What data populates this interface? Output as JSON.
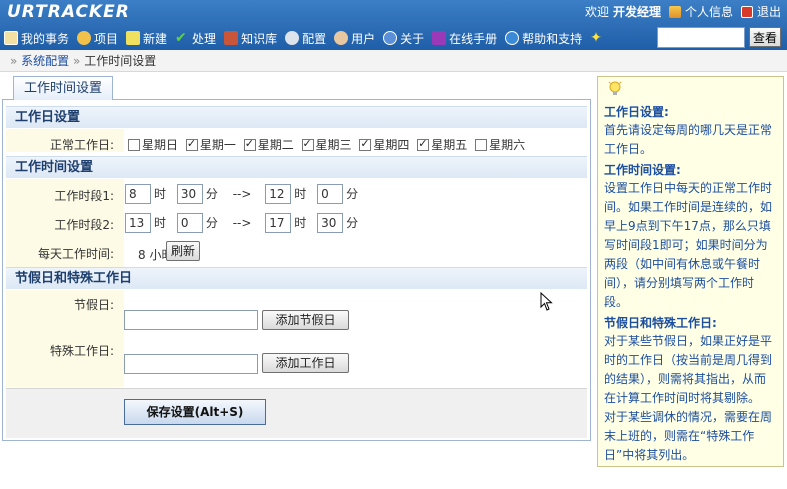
{
  "header": {
    "logo": "URTRACKER",
    "welcome": "欢迎",
    "username": "开发经理",
    "profile_link": "个人信息",
    "logout_link": "退出"
  },
  "nav": [
    {
      "label": "我的事务",
      "icon": "home-icon"
    },
    {
      "label": "项目",
      "icon": "project-icon"
    },
    {
      "label": "新建",
      "icon": "new-icon"
    },
    {
      "label": "处理",
      "icon": "check-icon"
    },
    {
      "label": "知识库",
      "icon": "knowledge-icon"
    },
    {
      "label": "配置",
      "icon": "gear-icon"
    },
    {
      "label": "用户",
      "icon": "users-icon"
    },
    {
      "label": "关于",
      "icon": "info-icon"
    },
    {
      "label": "在线手册",
      "icon": "book-icon"
    },
    {
      "label": "帮助和支持",
      "icon": "help-icon"
    }
  ],
  "search": {
    "value": "",
    "button": "查看"
  },
  "breadcrumb": {
    "sep": "»",
    "parent": "系统配置",
    "current": "工作时间设置"
  },
  "tab": "工作时间设置",
  "sections": {
    "workdays": "工作日设置",
    "worktime": "工作时间设置",
    "holidays": "节假日和特殊工作日"
  },
  "workdays": {
    "label": "正常工作日:",
    "days": [
      {
        "name": "星期日",
        "checked": false
      },
      {
        "name": "星期一",
        "checked": true
      },
      {
        "name": "星期二",
        "checked": true
      },
      {
        "name": "星期三",
        "checked": true
      },
      {
        "name": "星期四",
        "checked": true
      },
      {
        "name": "星期五",
        "checked": true
      },
      {
        "name": "星期六",
        "checked": false
      }
    ]
  },
  "worktime": {
    "period1": {
      "label": "工作时段1:",
      "start_h": "8",
      "start_m": "30",
      "end_h": "12",
      "end_m": "0"
    },
    "period2": {
      "label": "工作时段2:",
      "start_h": "13",
      "start_m": "0",
      "end_h": "17",
      "end_m": "30"
    },
    "hour_unit": "时",
    "min_unit": "分",
    "arrow": "-->",
    "daily_label": "每天工作时间:",
    "daily_value": "8 小时",
    "refresh_btn": "刷新"
  },
  "holidays": {
    "holiday_label": "节假日:",
    "holiday_btn": "添加节假日",
    "special_label": "特殊工作日:",
    "special_btn": "添加工作日"
  },
  "save_btn": "保存设置(Alt+S)",
  "help": {
    "h1": "工作日设置:",
    "p1": "首先请设定每周的哪几天是正常工作日。",
    "h2": "工作时间设置:",
    "p2": "设置工作日中每天的正常工作时间。如果工作时间是连续的，如早上9点到下午17点，那么只填写时间段1即可；如果时间分为两段（如中间有休息或午餐时间），请分别填写两个工作时段。",
    "h3": "节假日和特殊工作日:",
    "p3": "对于某些节假日，如果正好是平时的工作日（按当前是周几得到的结果），则需将其指出，从而在计算工作时间时将其剔除。",
    "p4": "对于某些调休的情况，需要在周末上班的，则需在“特殊工作日”中将其列出。"
  },
  "colors": {
    "header_blue": "#2a6cb8",
    "section_text": "#1e3f6e",
    "help_bg": "#ffffe6"
  }
}
